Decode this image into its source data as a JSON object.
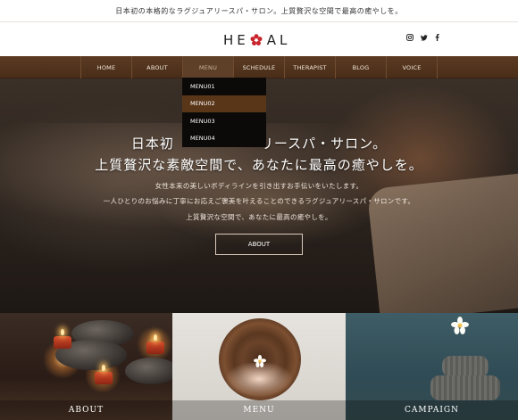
{
  "announcement": "日本初の本格的なラグジュアリースパ・サロン。上質贅沢な空間で最高の癒やしを。",
  "logo": {
    "left": "HE",
    "right": "AL",
    "icon": "red-flower-icon",
    "accent": "#c8242b"
  },
  "social": [
    {
      "name": "instagram-icon",
      "glyph": "◎"
    },
    {
      "name": "twitter-icon",
      "glyph": "🐦"
    },
    {
      "name": "facebook-icon",
      "glyph": "f"
    }
  ],
  "nav": {
    "items": [
      "HOME",
      "ABOUT",
      "MENU",
      "SCHEDULE",
      "THERAPIST",
      "BLOG",
      "VOICE"
    ],
    "active": "MENU"
  },
  "dropdown": {
    "items": [
      "MENU01",
      "MENU02",
      "MENU03",
      "MENU04"
    ],
    "highlighted": "MENU02"
  },
  "hero": {
    "headline1_left": "日本初",
    "headline1_right": "リースパ・サロン。",
    "headline2": "上質贅沢な素敵空間で、あなたに最高の癒やしを。",
    "lines": [
      "女性本来の美しいボディラインを引き出すお手伝いをいたします。",
      "一人ひとりのお悩みに丁寧にお応えご褒美を叶えることのできるラグジュアリースパ・サロンです。",
      "上質贅沢な空間で、あなたに最高の癒やしを。"
    ],
    "button": "ABOUT"
  },
  "tiles": [
    {
      "label": "ABOUT"
    },
    {
      "label": "MENU"
    },
    {
      "label": "CAMPAIGN"
    }
  ],
  "colors": {
    "nav_bg": "#4f321c",
    "dropdown_bg": "#0c0a09",
    "dropdown_highlight": "#5a3619"
  }
}
